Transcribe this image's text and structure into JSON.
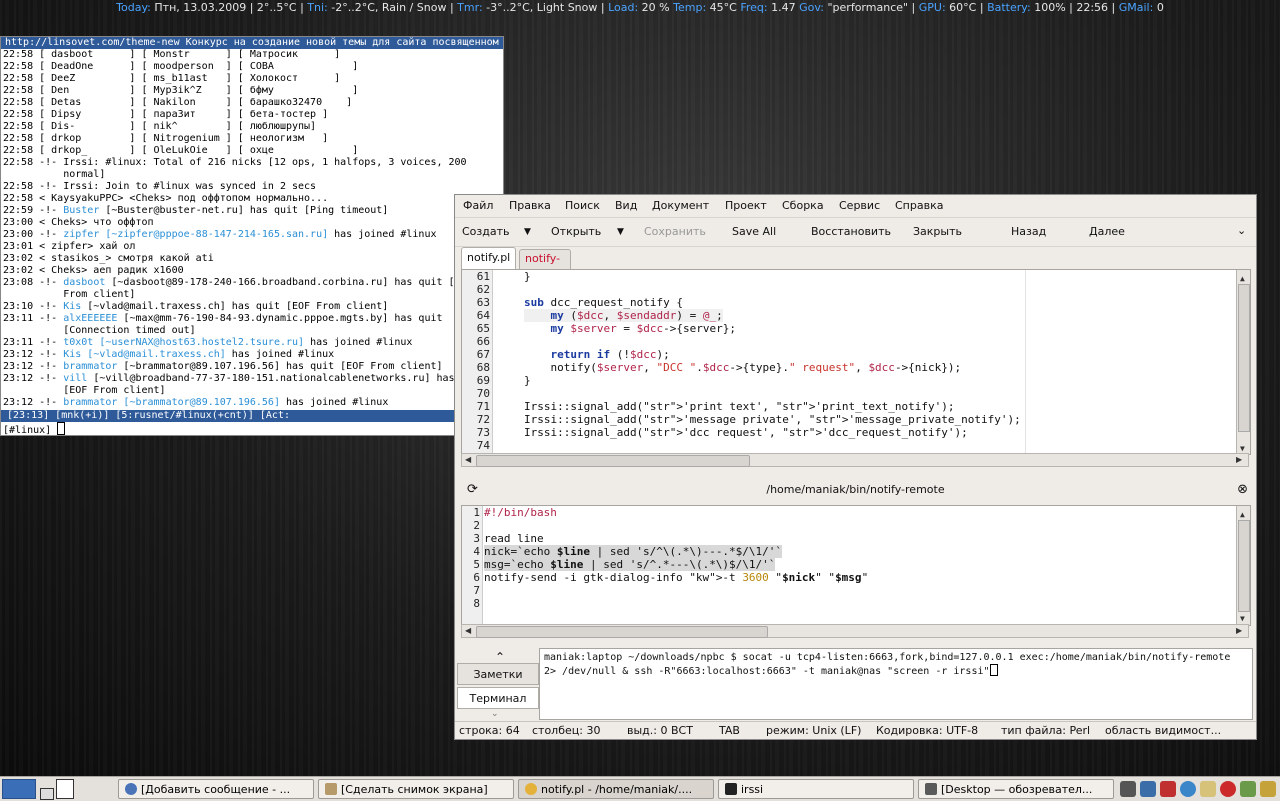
{
  "statusbar": {
    "today_label": "Today:",
    "today_value": " Птн, 13.03.2009 | 2°..5°C |",
    "tni_label": " Tni:",
    "tni_value": " -2°..2°C, Rain / Snow |",
    "tmr_label": " Tmr:",
    "tmr_value": " -3°..2°C, Light Snow |",
    "load_label": " Load:",
    "load_value": " 20 % ",
    "temp_label": " Temp:",
    "temp_value": " 45°C",
    "freq_label": " Freq:",
    "freq_value": " 1.47",
    "gov_label": " Gov:",
    "gov_value": " \"performance\" |",
    "gpu_label": " GPU:",
    "gpu_value": " 60°C |",
    "battery_label": " Battery:",
    "battery_value": " 100%  | 22:56 |",
    "gmail_label": " GMail:",
    "gmail_value": "  0"
  },
  "irssi": {
    "topic": "http://linsovet.com/theme-new Конкурс на создание новой темы для сайта посвященном",
    "nicklines": [
      "22:58 [ dasboot      ] [ Monstr      ] [ Матросик      ]",
      "22:58 [ DeadOne      ] [ moodperson  ] [ СОВА             ]",
      "22:58 [ DeeZ         ] [ ms_b11ast   ] [ Холокост      ]",
      "22:58 [ Den          ] [ Myp3ik^Z    ] [ бфму             ]",
      "22:58 [ Detas        ] [ Nakilon     ] [ барашко32470    ]",
      "22:58 [ Dipsy        ] [ пара3ит     ] [ бета-тостер ]",
      "22:58 [ Dis-         ] [ nik^        ] [ люблюшрупы]",
      "22:58 [ drkop        ] [ Nitrogenium ] [ неологизм   ]",
      "22:58 [ drkop_       ] [ OleLukOie   ] [ охце             ]"
    ],
    "l1a": "22:58 -!- Irssi: #linux: Total of 216 nicks [12 ops, 1 halfops, 3 voices, 200",
    "l1b": "          normal]",
    "l2": "22:58 -!- Irssi: Join to #linux was synced in 2 secs",
    "l3": "22:58 < KaysyakuPPC> <Cheks> под оффтопом нормально...",
    "l4a": "22:59 -!- ",
    "l4nick": "Buster",
    "l4b": " [~Buster@buster-net.ru] has quit [Ping timeout]",
    "l5": "23:00 < Cheks> что оффтоп",
    "l6a": "23:00 -!- ",
    "l6nick": "zipfer",
    "l6host": " [~zipfer@pppoe-88-147-214-165.san.ru]",
    "l6b": " has joined #linux",
    "l7": "23:01 < zipfer> хай ол",
    "l8": "23:02 < stasikos_> смотря какой ati",
    "l9": "23:02 < Cheks> аеп радик х1600",
    "l10a": "23:08 -!- ",
    "l10nick": "dasboot",
    "l10b": " [~dasboot@89-178-240-166.broadband.corbina.ru] has quit [",
    "l10c": "          From client]",
    "l11a": "23:10 -!- ",
    "l11nick": "Kis",
    "l11b": " [~vlad@mail.traxess.ch] has quit [EOF From client]",
    "l12a": "23:11 -!- ",
    "l12nick": "alxEEEEEE",
    "l12b": " [~max@mm-76-190-84-93.dynamic.pppoe.mgts.by] has quit",
    "l12c": "          [Connection timed out]",
    "l13a": "23:11 -!- ",
    "l13nick": "t0x0t",
    "l13host": " [~userNAX@host63.hostel2.tsure.ru]",
    "l13b": " has joined #linux",
    "l14a": "23:12 -!- ",
    "l14nick": "Kis",
    "l14host": " [~vlad@mail.traxess.ch]",
    "l14b": " has joined #linux",
    "l15a": "23:12 -!- ",
    "l15nick": "brammator",
    "l15b": " [~brammator@89.107.196.56] has quit [EOF From client]",
    "l16a": "23:12 -!- ",
    "l16nick": "vill",
    "l16b": " [~vill@broadband-77-37-180-151.nationalcablenetworks.ru] has",
    "l16c": "          [EOF From client]",
    "l17a": "23:12 -!- ",
    "l17nick": "brammator",
    "l17host": " [~brammator@89.107.196.56]",
    "l17b": " has joined #linux",
    "statusbar": " [23:13] [mnk(+i)] [5:rusnet/#linux(+cnt)] [Act: ",
    "prompt": "[#linux] "
  },
  "kate": {
    "menu": {
      "file": "Файл",
      "edit": "Правка",
      "search": "Поиск",
      "view": "Вид",
      "document": "Документ",
      "project": "Проект",
      "build": "Сборка",
      "service": "Сервис",
      "help": "Справка"
    },
    "toolbar": {
      "create": "Создать",
      "open": "Открыть",
      "save": "Сохранить",
      "saveall": "Save All",
      "restore": "Восстановить",
      "close": "Закрыть",
      "back": "Назад",
      "forward": "Далее"
    },
    "tabs": {
      "active": "notify.pl",
      "inactive": "notify-remote"
    },
    "code1": [
      {
        "n": "61",
        "t": "}"
      },
      {
        "n": "62",
        "t": ""
      },
      {
        "n": "63",
        "t": "sub dcc_request_notify {"
      },
      {
        "n": "64",
        "t": "    my ($dcc, $sendaddr) = @_;"
      },
      {
        "n": "65",
        "t": "    my $server = $dcc->{server};"
      },
      {
        "n": "66",
        "t": ""
      },
      {
        "n": "67",
        "t": "    return if (!$dcc);"
      },
      {
        "n": "68",
        "t": "    notify($server, \"DCC \".$dcc->{type}.\" request\", $dcc->{nick});"
      },
      {
        "n": "69",
        "t": "}"
      },
      {
        "n": "70",
        "t": ""
      },
      {
        "n": "71",
        "t": "Irssi::signal_add('print text', 'print_text_notify');"
      },
      {
        "n": "72",
        "t": "Irssi::signal_add('message private', 'message_private_notify');"
      },
      {
        "n": "73",
        "t": "Irssi::signal_add('dcc request', 'dcc_request_notify');"
      },
      {
        "n": "74",
        "t": ""
      }
    ],
    "pane2_title": "/home/maniak/bin/notify-remote",
    "code2": [
      {
        "n": "1",
        "t": "#!/bin/bash"
      },
      {
        "n": "2",
        "t": ""
      },
      {
        "n": "3",
        "t": "read line"
      },
      {
        "n": "4",
        "t": "nick=`echo $line | sed 's/^\\(.*\\)---.*$/\\1/'`"
      },
      {
        "n": "5",
        "t": "msg=`echo $line | sed 's/^.*---\\(.*\\)$/\\1/'`"
      },
      {
        "n": "6",
        "t": "notify-send -i gtk-dialog-info -t 3600 \"$nick\" \"$msg\""
      },
      {
        "n": "7",
        "t": ""
      },
      {
        "n": "8",
        "t": ""
      }
    ],
    "side": {
      "notes": "Заметки",
      "terminal": "Терминал"
    },
    "konsole": {
      "l1": "maniak:laptop ~/downloads/npbc $ socat -u tcp4-listen:6663,fork,bind=127.0.0.1 exec:/home/maniak/bin/notify-remote",
      "l2": "2> /dev/null & ssh -R\"6663:localhost:6663\" -t maniak@nas \"screen -r irssi\""
    },
    "status": {
      "line": "строка: 64",
      "col": "столбец: 30",
      "sel": "выд.: 0 ВСТ",
      "tab": "TAB",
      "mode": "режим: Unix (LF)",
      "enc": "Кодировка: UTF-8",
      "type": "тип файла: Perl",
      "area": "область видимост..."
    }
  },
  "taskbar": {
    "t1": "[Добавить сообщение - ...",
    "t2": "[Сделать снимок экрана]",
    "t3": "notify.pl - /home/maniak/....",
    "t4": "irssi",
    "t5": "[Desktop — обозревател..."
  },
  "colors": {
    "accent": "#4aa3ff",
    "nick": "#2a8fd6",
    "irssi_bar": "#2f5a99",
    "keyword": "#1a3aa0",
    "variable": "#b0244a",
    "string": "#c8332b",
    "tab_inactive": "#c8102e"
  }
}
